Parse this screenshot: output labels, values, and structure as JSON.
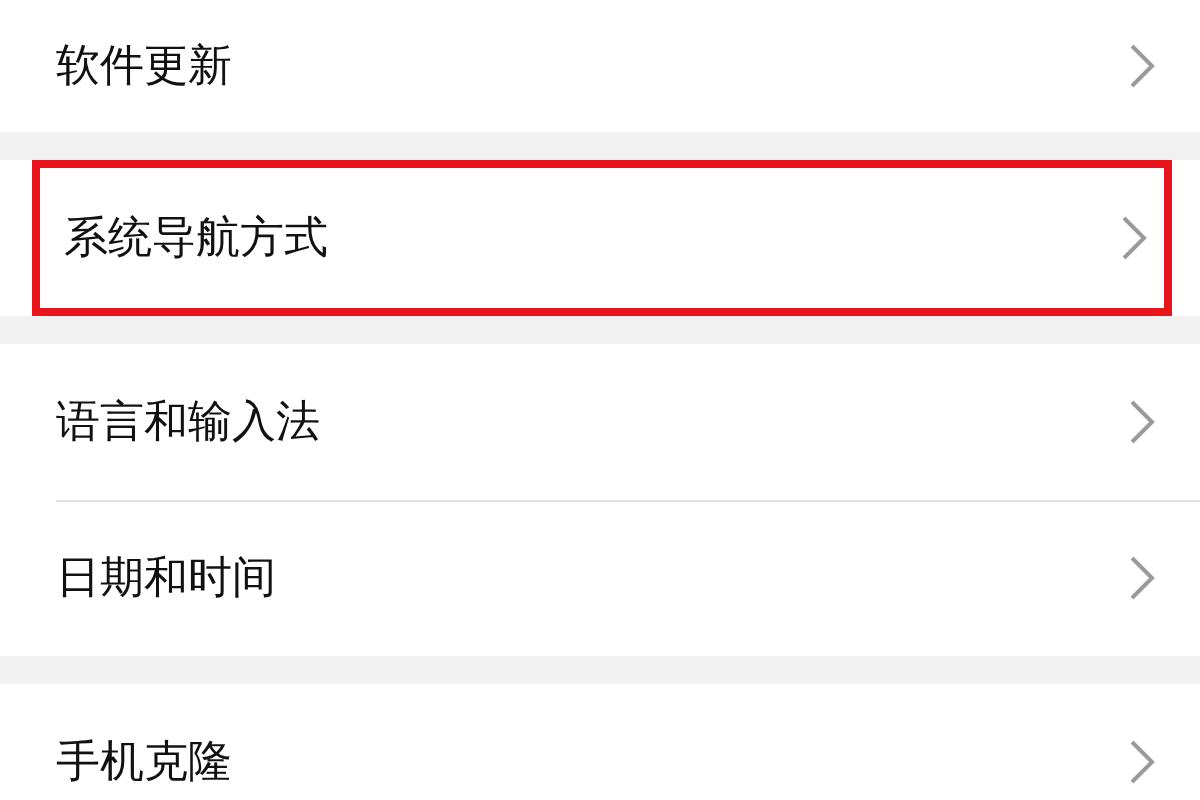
{
  "groups": [
    {
      "items": [
        {
          "label": "软件更新",
          "highlighted": false
        }
      ]
    },
    {
      "items": [
        {
          "label": "系统导航方式",
          "highlighted": true
        }
      ]
    },
    {
      "items": [
        {
          "label": "语言和输入法",
          "highlighted": false
        },
        {
          "label": "日期和时间",
          "highlighted": false
        }
      ]
    },
    {
      "items": [
        {
          "label": "手机克隆",
          "highlighted": false
        }
      ]
    }
  ]
}
